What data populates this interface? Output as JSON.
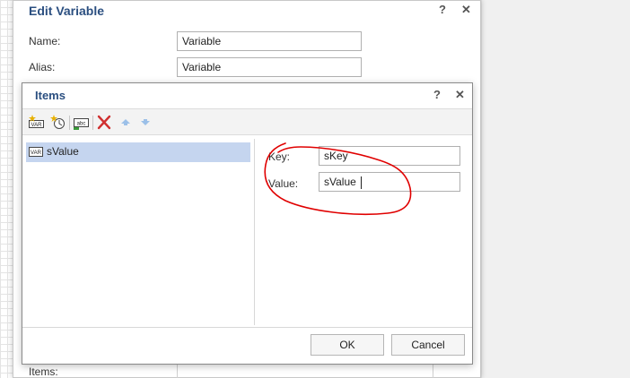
{
  "outer_dialog": {
    "title": "Edit Variable",
    "help_label": "?",
    "close_label": "✕",
    "fields": [
      {
        "label": "Name:",
        "value": "Variable"
      },
      {
        "label": "Alias:",
        "value": "Variable"
      }
    ],
    "items_label": "Items:"
  },
  "items_dialog": {
    "title": "Items",
    "help_label": "?",
    "close_label": "✕",
    "toolbar": {
      "buttons": [
        "add-variable-icon",
        "add-expression-icon",
        "add-value-icon",
        "delete-icon",
        "move-up-icon",
        "move-down-icon"
      ]
    },
    "list": [
      {
        "label": "sValue",
        "selected": true
      }
    ],
    "properties": {
      "key_label": "Key:",
      "key_value": "sKey",
      "value_label": "Value:",
      "value_value": "sValue"
    },
    "ok_label": "OK",
    "cancel_label": "Cancel"
  },
  "colors": {
    "title": "#2b4f80",
    "selection": "#c5d5ef",
    "annotation": "#e00000"
  }
}
